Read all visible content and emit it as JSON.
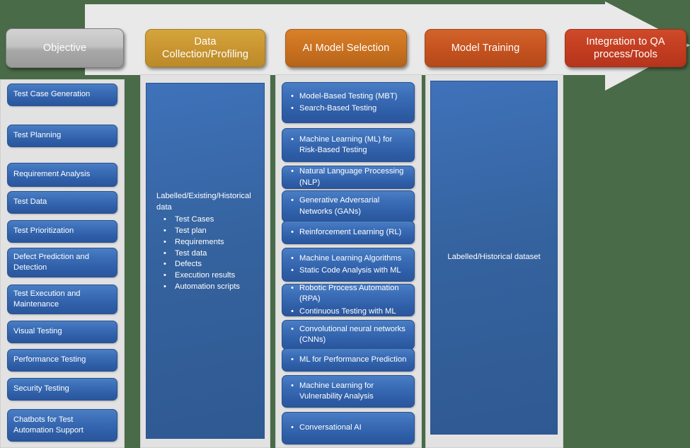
{
  "background_color": "#4a6b48",
  "arrow": {
    "name": "process-flow-arrow",
    "fill": "#e9e9e9"
  },
  "header": {
    "stages": [
      {
        "label": "Objective",
        "color": "#b5b5b5"
      },
      {
        "label": "Data Collection/Profiling",
        "color": "#c89430"
      },
      {
        "label": "AI Model Selection",
        "color": "#c9701f"
      },
      {
        "label": "Model Training",
        "color": "#c4521f"
      },
      {
        "label": "Integration to QA process/Tools",
        "color": "#c23c20"
      }
    ]
  },
  "columns": {
    "objective": {
      "items": [
        "Test Case Generation",
        "Test Planning",
        "Requirement Analysis",
        "Test Data",
        "Test Prioritization",
        "Defect Prediction and Detection",
        "Test Execution and Maintenance",
        "Visual Testing",
        "Performance Testing",
        "Security Testing",
        "Chatbots for Test Automation Support"
      ]
    },
    "data_collection": {
      "headline": "Labelled/Existing/Historical data",
      "items": [
        "Test Cases",
        "Test plan",
        "Requirements",
        "Test data",
        "Defects",
        "Execution results",
        "Automation scripts"
      ]
    },
    "ai_model_selection": {
      "groups": [
        {
          "items": [
            "Model-Based Testing (MBT)",
            "Search-Based Testing"
          ]
        },
        {
          "items": [
            "Machine Learning (ML) for Risk-Based Testing"
          ]
        },
        {
          "items": [
            "Natural Language Processing (NLP)"
          ]
        },
        {
          "items": [
            "Generative Adversarial Networks (GANs)"
          ]
        },
        {
          "items": [
            "Reinforcement Learning (RL)"
          ]
        },
        {
          "items": [
            "Machine Learning Algorithms",
            "Static Code Analysis with ML"
          ]
        },
        {
          "items": [
            "Robotic Process Automation (RPA)",
            "Continuous Testing with ML"
          ]
        },
        {
          "items": [
            "Convolutional neural networks (CNNs)"
          ]
        },
        {
          "items": [
            "ML for Performance Prediction"
          ]
        },
        {
          "items": [
            "Machine Learning for Vulnerability Analysis"
          ]
        },
        {
          "items": [
            "Conversational AI"
          ]
        }
      ],
      "bullet": "•"
    },
    "model_training": {
      "label": "Labelled/Historical dataset"
    }
  }
}
